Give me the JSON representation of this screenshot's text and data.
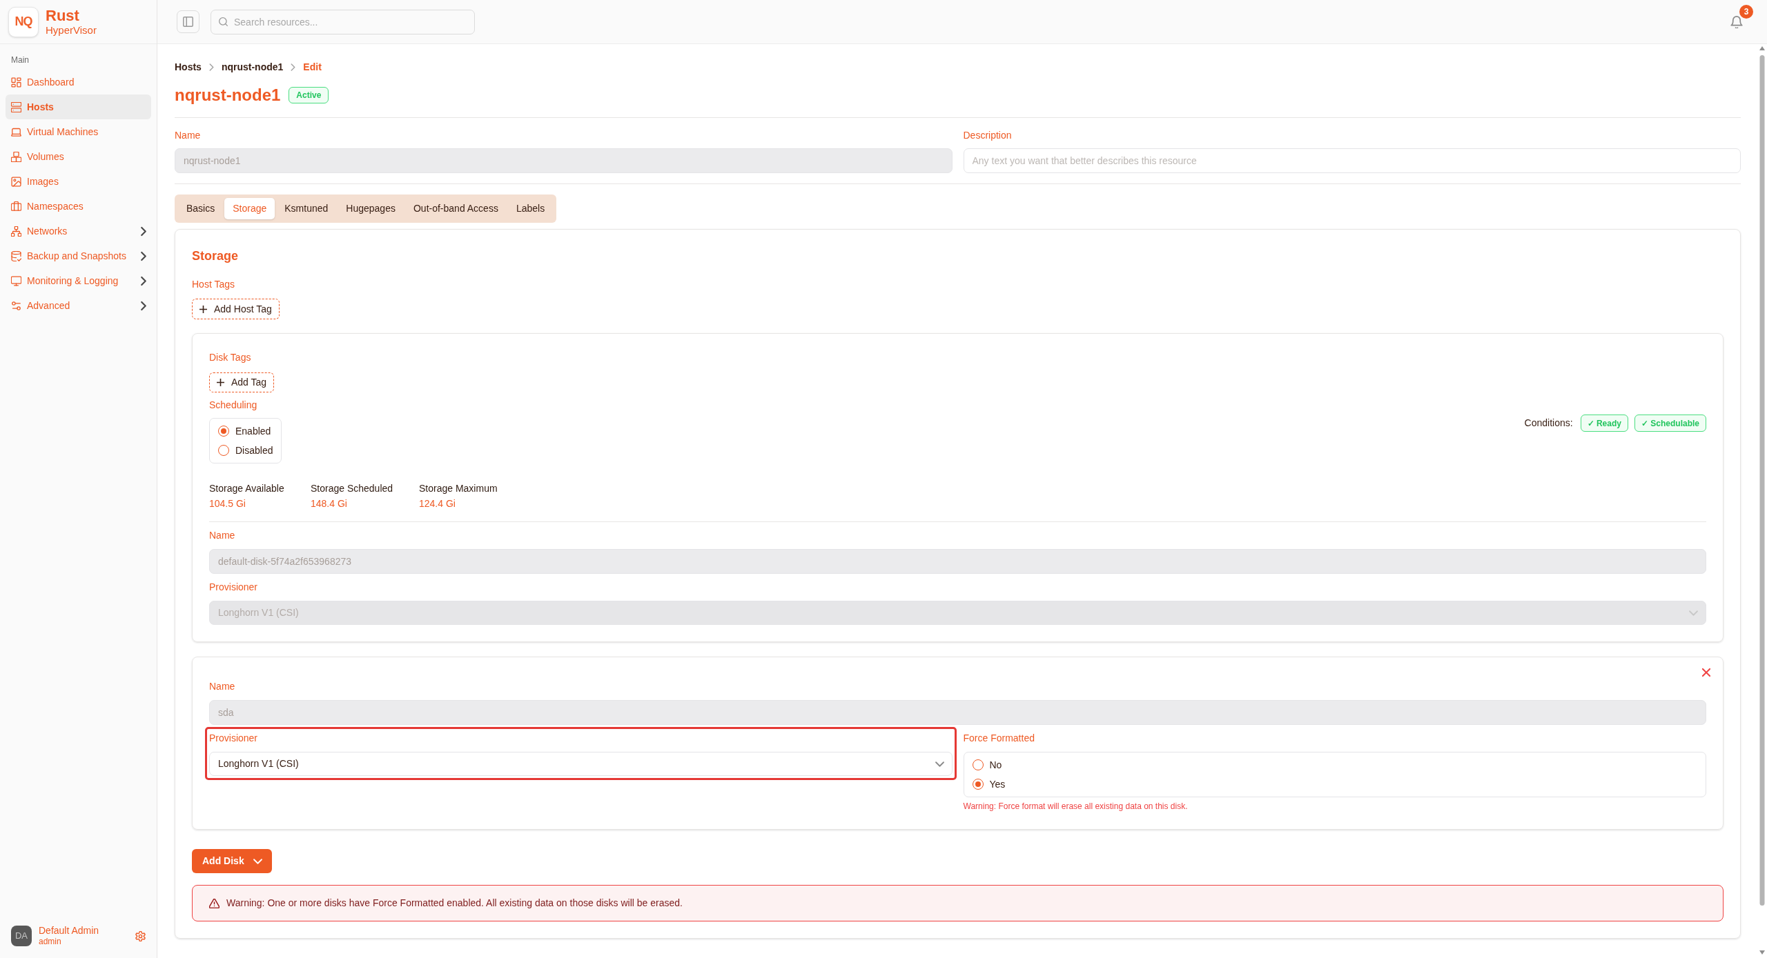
{
  "sidebar": {
    "logo": {
      "mark": "NQ",
      "title": "Rust",
      "subtitle": "HyperVisor"
    },
    "section_label": "Main",
    "items": [
      {
        "label": "Dashboard",
        "selected": false,
        "has_submenu": false
      },
      {
        "label": "Hosts",
        "selected": true,
        "has_submenu": false
      },
      {
        "label": "Virtual Machines",
        "selected": false,
        "has_submenu": false
      },
      {
        "label": "Volumes",
        "selected": false,
        "has_submenu": false
      },
      {
        "label": "Images",
        "selected": false,
        "has_submenu": false
      },
      {
        "label": "Namespaces",
        "selected": false,
        "has_submenu": false
      },
      {
        "label": "Networks",
        "selected": false,
        "has_submenu": true
      },
      {
        "label": "Backup and Snapshots",
        "selected": false,
        "has_submenu": true
      },
      {
        "label": "Monitoring & Logging",
        "selected": false,
        "has_submenu": true
      },
      {
        "label": "Advanced",
        "selected": false,
        "has_submenu": true
      }
    ],
    "user": {
      "initials": "DA",
      "name": "Default Admin",
      "role": "admin"
    }
  },
  "topbar": {
    "search": {
      "placeholder": "Search resources..."
    },
    "notification_count": "3"
  },
  "breadcrumb": [
    {
      "label": "Hosts",
      "current": false
    },
    {
      "label": "nqrust-node1",
      "current": false
    },
    {
      "label": "Edit",
      "current": true
    }
  ],
  "header": {
    "title": "nqrust-node1",
    "status": "Active"
  },
  "fields": [
    {
      "label": "Name",
      "value": "nqrust-node1",
      "disabled": true
    },
    {
      "label": "Description",
      "placeholder": "Any text you want that better describes this resource",
      "disabled": false
    }
  ],
  "tabs": [
    {
      "label": "Basics",
      "selected": false
    },
    {
      "label": "Storage",
      "selected": true
    },
    {
      "label": "Ksmtuned",
      "selected": false
    },
    {
      "label": "Hugepages",
      "selected": false
    },
    {
      "label": "Out-of-band Access",
      "selected": false
    },
    {
      "label": "Labels",
      "selected": false
    }
  ],
  "storage": {
    "title": "Storage",
    "host_tags": {
      "label": "Host Tags",
      "add_button": "Add Host Tag"
    },
    "disks": [
      {
        "removable": false,
        "disk_tags": {
          "label": "Disk Tags",
          "add_button": "Add Tag"
        },
        "scheduling": {
          "label": "Scheduling",
          "options": [
            {
              "label": "Enabled",
              "selected": true
            },
            {
              "label": "Disabled",
              "selected": false
            }
          ]
        },
        "conditions": {
          "label": "Conditions:",
          "items": [
            "✓ Ready",
            "✓ Schedulable"
          ]
        },
        "stats": [
          {
            "label": "Storage Available",
            "value": "104.5 Gi"
          },
          {
            "label": "Storage Scheduled",
            "value": "148.4 Gi"
          },
          {
            "label": "Storage Maximum",
            "value": "124.4 Gi"
          }
        ],
        "name": {
          "label": "Name",
          "value": "default-disk-5f74a2f653968273",
          "disabled": true
        },
        "provisioner": {
          "label": "Provisioner",
          "value": "Longhorn V1 (CSI)",
          "disabled": true,
          "highlighted": false
        }
      },
      {
        "removable": true,
        "name": {
          "label": "Name",
          "value": "sda",
          "disabled": true
        },
        "provisioner": {
          "label": "Provisioner",
          "value": "Longhorn V1 (CSI)",
          "disabled": false,
          "highlighted": true
        },
        "force_formatted": {
          "label": "Force Formatted",
          "options": [
            {
              "label": "No",
              "selected": false
            },
            {
              "label": "Yes",
              "selected": true
            }
          ],
          "warning": "Warning: Force format will erase all existing data on this disk."
        }
      }
    ],
    "add_disk_button": "Add Disk",
    "alert": "Warning: One or more disks have Force Formatted enabled. All existing data on those disks will be erased."
  }
}
